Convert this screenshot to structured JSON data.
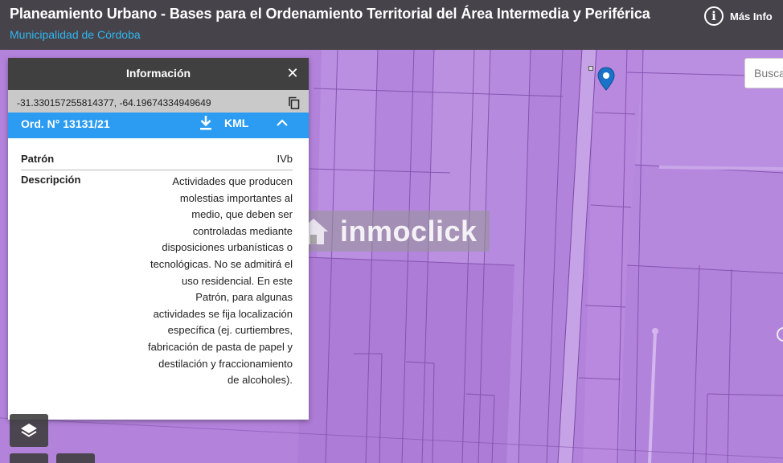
{
  "header": {
    "title": "Planeamiento Urbano - Bases para el Ordenamiento Territorial del Área Intermedia y Periférica",
    "subtitle": "Municipalidad de Córdoba",
    "info_label": "Más Info"
  },
  "search": {
    "placeholder": "Buscar"
  },
  "info_panel": {
    "title": "Información",
    "coordinates": "-31.330157255814377, -64.19674334949649",
    "ordinance": "Ord. N° 13131/21",
    "kml_label": "KML",
    "rows": {
      "patron_label": "Patrón",
      "patron_value": "IVb",
      "descripcion_label": "Descripción",
      "descripcion_value": "Actividades que producen molestias importantes al medio, que deben ser controladas mediante disposiciones urbanísticas o tecnológicas. No se admitirá el uso residencial. En este Patrón, para algunas actividades se fija localización específica (ej. curtiembres, fabricación de pasta de papel y destilación y fraccionamiento de alcoholes)."
    }
  },
  "watermark": {
    "text": "inmoclick"
  },
  "colors": {
    "map_fill": "#b07fd9",
    "header_bg": "#3e3e3e",
    "accent_blue": "#2b9cf2",
    "subtitle_cyan": "#2fb6f0",
    "marker_blue": "#1a73c9"
  },
  "icons": [
    "info-icon",
    "close-icon",
    "copy-icon",
    "download-icon",
    "chevron-up-icon",
    "location-marker-icon",
    "layers-icon",
    "house-icon"
  ]
}
